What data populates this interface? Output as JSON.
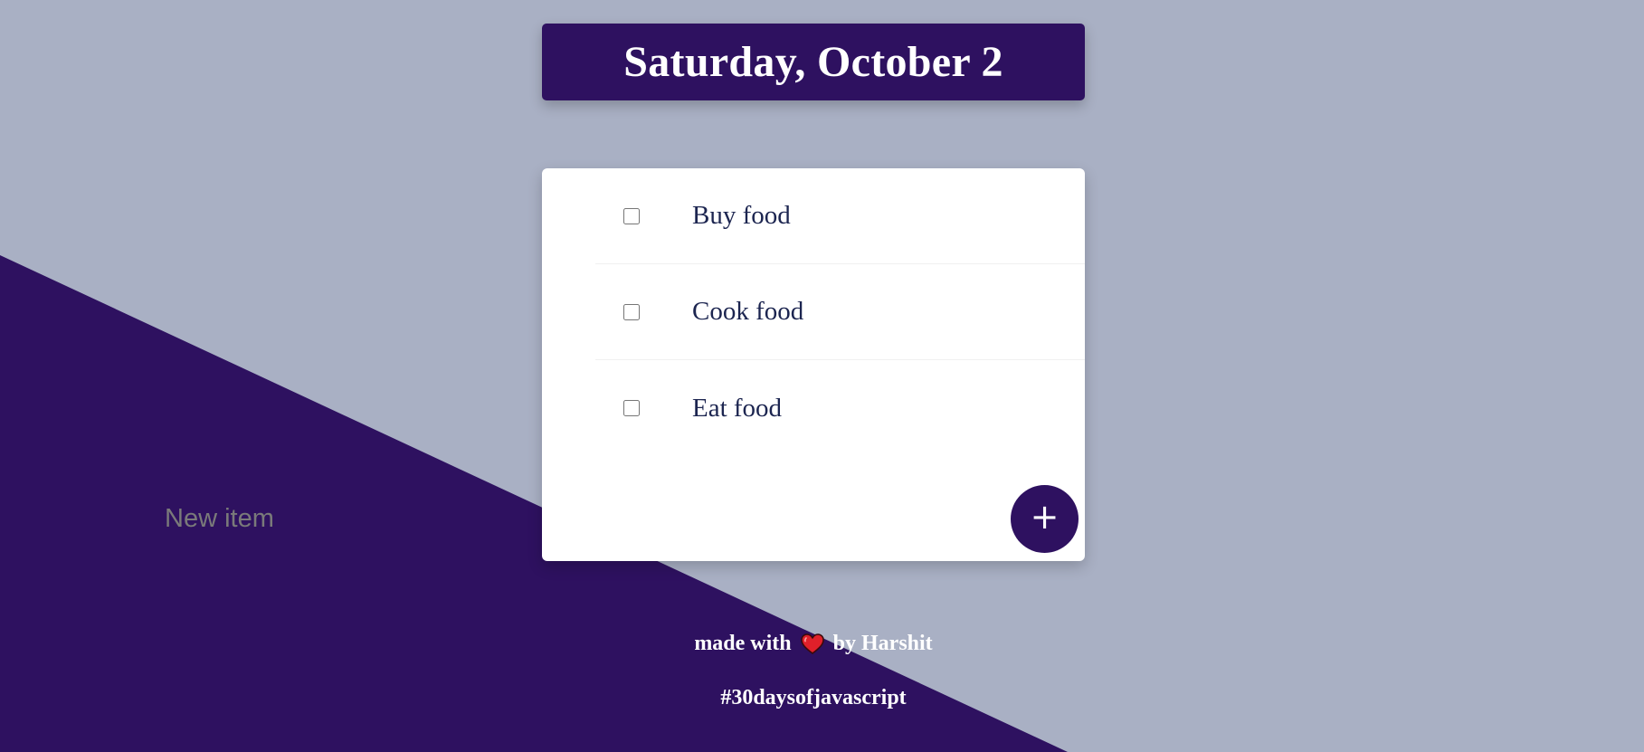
{
  "header": {
    "date": "Saturday, October 2"
  },
  "todos": [
    {
      "label": "Buy food",
      "checked": false
    },
    {
      "label": "Cook food",
      "checked": false
    },
    {
      "label": "Eat food",
      "checked": false
    }
  ],
  "new_item": {
    "placeholder": "New item",
    "value": "",
    "add_label": "+"
  },
  "footer": {
    "made_with": "made with",
    "heart": "heart-icon",
    "by": "by Harshit",
    "hashtag": "#30daysofjavascript"
  },
  "colors": {
    "background": "#a9b0c4",
    "accent": "#2e1160",
    "card": "#ffffff",
    "text": "#1c2550",
    "heart": "#e0202a"
  }
}
